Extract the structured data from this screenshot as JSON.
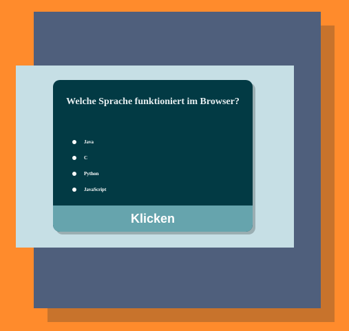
{
  "colors": {
    "background": "#ff8b2c",
    "navy_panel": "#4f5f7c",
    "light_panel": "#c6dfe5",
    "card": "#023a44",
    "button": "#66a4ad"
  },
  "quiz": {
    "question": "Welche Sprache funktioniert im Browser?",
    "options": [
      "Java",
      "C",
      "Python",
      "JavaScript"
    ],
    "submit_label": "Klicken"
  }
}
